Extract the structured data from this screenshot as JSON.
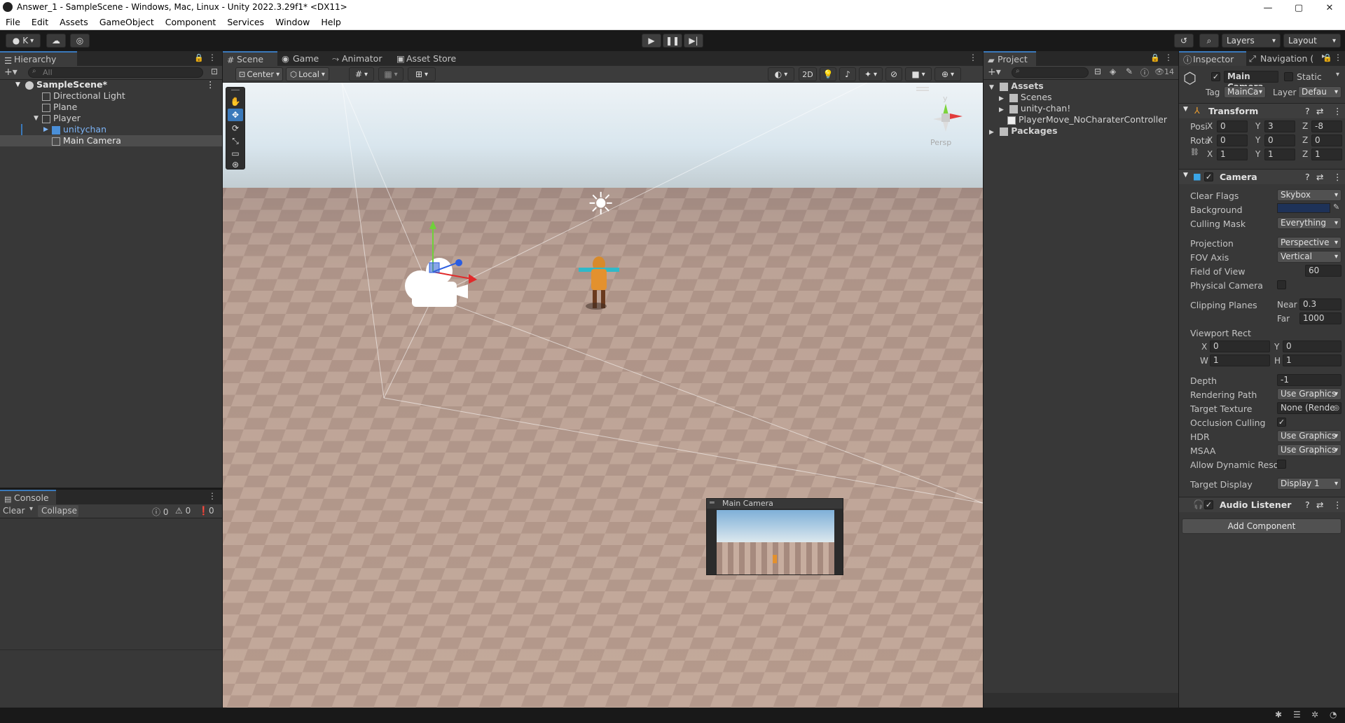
{
  "window": {
    "title": "Answer_1 - SampleScene - Windows, Mac, Linux - Unity 2022.3.29f1* <DX11>",
    "controls": [
      "—",
      "▢",
      "✕"
    ]
  },
  "menu": [
    "File",
    "Edit",
    "Assets",
    "GameObject",
    "Component",
    "Services",
    "Window",
    "Help"
  ],
  "toolbar": {
    "account_label": "K",
    "layers_label": "Layers",
    "layout_label": "Layout"
  },
  "hierarchy": {
    "tab": "Hierarchy",
    "search_placeholder": "All",
    "items": [
      {
        "label": "SampleScene*"
      },
      {
        "label": "Directional Light"
      },
      {
        "label": "Plane"
      },
      {
        "label": "Player"
      },
      {
        "label": "unitychan"
      },
      {
        "label": "Main Camera"
      }
    ]
  },
  "console": {
    "tab": "Console",
    "clear_label": "Clear",
    "collapse_label": "Collapse",
    "log_count": "0",
    "warn_count": "0",
    "error_count": "0"
  },
  "scene": {
    "tabs": [
      "Scene",
      "Game",
      "Animator",
      "Asset Store"
    ],
    "pivot_label": "Center",
    "space_label": "Local",
    "mode_2d": "2D",
    "persp_label": "Persp",
    "gizmo_y": "y",
    "camera_preview_title": "Main Camera"
  },
  "project": {
    "tab": "Project",
    "hidden_count": "14",
    "tree": [
      {
        "label": "Assets"
      },
      {
        "label": "Scenes"
      },
      {
        "label": "unity-chan!"
      },
      {
        "label": "PlayerMove_NoCharaterController"
      },
      {
        "label": "Packages"
      }
    ]
  },
  "inspector": {
    "tabs": [
      "Inspector",
      "Navigation ("
    ],
    "object_name": "Main Camera",
    "static_label": "Static",
    "tag_label": "Tag",
    "tag_value": "MainCa",
    "layer_label": "Layer",
    "layer_value": "Defau",
    "transform": {
      "title": "Transform",
      "pos_label": "Posi",
      "rot_label": "Rota",
      "scale_label": "",
      "position": {
        "x": "0",
        "y": "3",
        "z": "-8"
      },
      "rotation": {
        "x": "0",
        "y": "0",
        "z": "0"
      },
      "scale": {
        "x": "1",
        "y": "1",
        "z": "1"
      },
      "axis_x": "X",
      "axis_y": "Y",
      "axis_z": "Z"
    },
    "camera": {
      "title": "Camera",
      "clear_flags_label": "Clear Flags",
      "clear_flags_value": "Skybox",
      "background_label": "Background",
      "background_color": "#1e3258",
      "culling_mask_label": "Culling Mask",
      "culling_mask_value": "Everything",
      "projection_label": "Projection",
      "projection_value": "Perspective",
      "fov_axis_label": "FOV Axis",
      "fov_axis_value": "Vertical",
      "fov_label": "Field of View",
      "fov_value": "60",
      "physical_label": "Physical Camera",
      "clipping_label": "Clipping Planes",
      "near_label": "Near",
      "near_value": "0.3",
      "far_label": "Far",
      "far_value": "1000",
      "viewport_label": "Viewport Rect",
      "vp_x_label": "X",
      "vp_x": "0",
      "vp_y_label": "Y",
      "vp_y": "0",
      "vp_w_label": "W",
      "vp_w": "1",
      "vp_h_label": "H",
      "vp_h": "1",
      "depth_label": "Depth",
      "depth_value": "-1",
      "rendering_path_label": "Rendering Path",
      "rendering_path_value": "Use Graphics",
      "target_texture_label": "Target Texture",
      "target_texture_value": "None (Rende",
      "occlusion_label": "Occlusion Culling",
      "hdr_label": "HDR",
      "hdr_value": "Use Graphics",
      "msaa_label": "MSAA",
      "msaa_value": "Use Graphics",
      "dynamic_res_label": "Allow Dynamic Resol",
      "target_display_label": "Target Display",
      "target_display_value": "Display 1"
    },
    "audio_listener_title": "Audio Listener",
    "add_component_label": "Add Component"
  },
  "colors": {
    "accent": "#3a79bb",
    "selection": "#4d4d4d",
    "sky_top": "#bfdcf1",
    "floor_light": "#c8ab9c",
    "floor_dark": "#8c6f64"
  }
}
